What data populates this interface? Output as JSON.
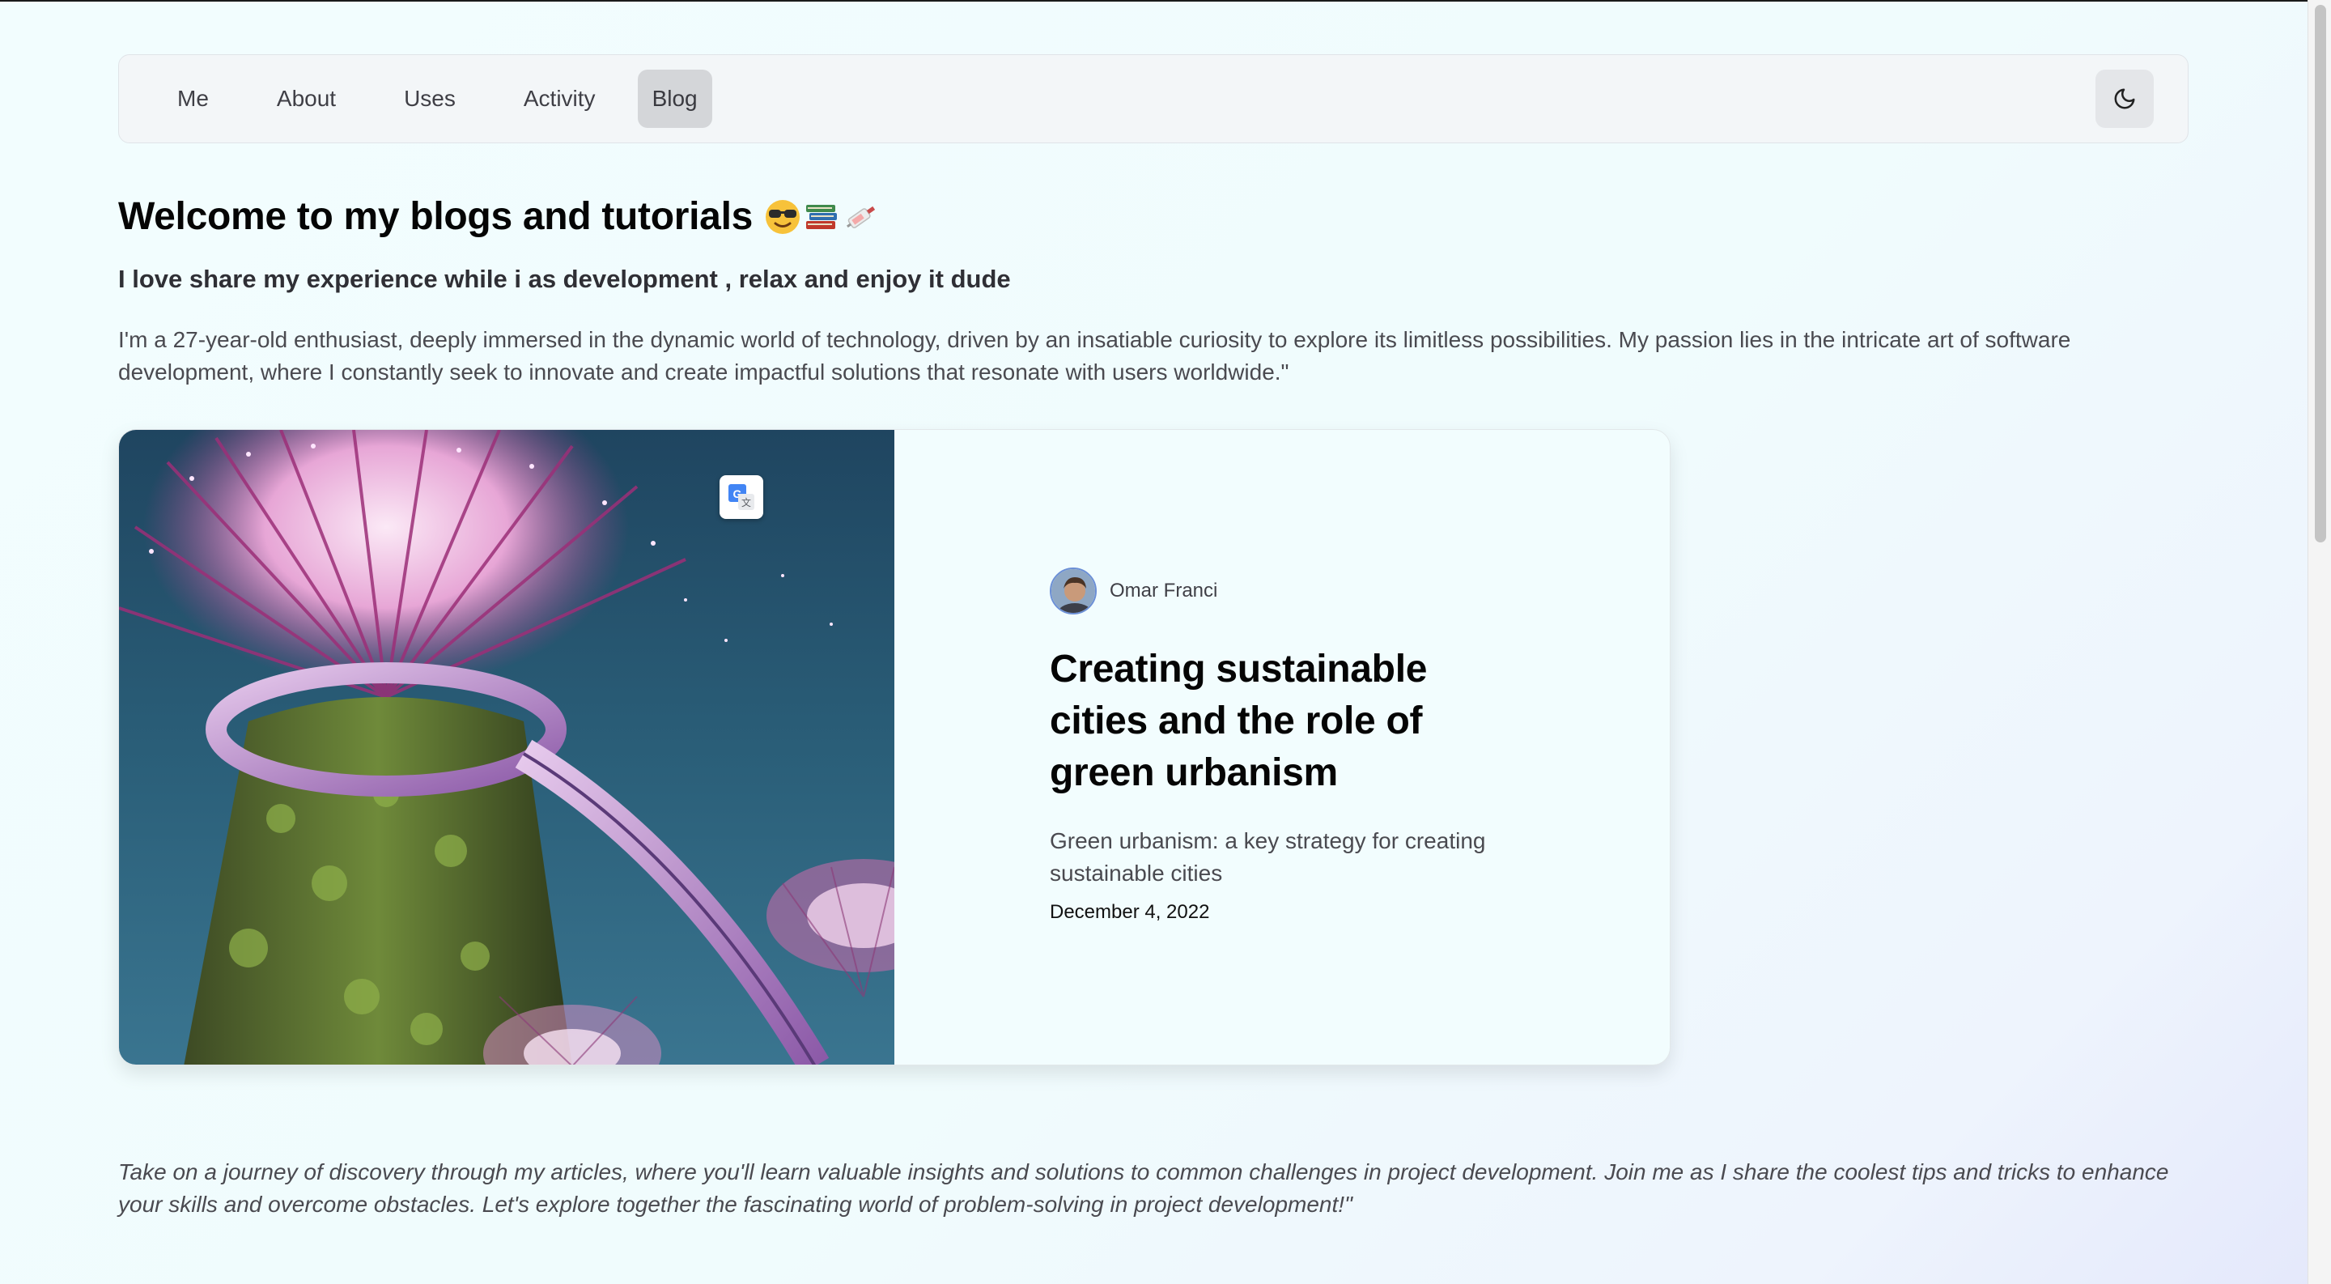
{
  "nav": {
    "items": [
      {
        "label": "Me"
      },
      {
        "label": "About"
      },
      {
        "label": "Uses"
      },
      {
        "label": "Activity"
      },
      {
        "label": "Blog",
        "active": true
      }
    ],
    "theme_toggle_icon": "moon-icon"
  },
  "header": {
    "title": "Welcome to my blogs and tutorials",
    "title_emojis": [
      "sunglasses-emoji",
      "books-emoji",
      "syringe-tag-emoji"
    ],
    "subtitle": "I love share my experience while i as development , relax and enjoy it dude",
    "intro": "I'm a 27-year-old enthusiast, deeply immersed in the dynamic world of technology, driven by an insatiable curiosity to explore its limitless possibilities. My passion lies in the intricate art of software development, where I constantly seek to innovate and create impactful solutions that resonate with users worldwide.\""
  },
  "post": {
    "author": "Omar Franci",
    "title": "Creating sustainable cities and the role of green urbanism",
    "description": "Green urbanism: a key strategy for creating sustainable cities",
    "date": "December 4, 2022",
    "image_icon": "supertree-grove-photo"
  },
  "footer": {
    "outro": "Take on a journey of discovery through my articles, where you'll learn valuable insights and solutions to common challenges in project development. Join me as I share the coolest tips and tricks to enhance your skills and overcome obstacles. Let's explore together the fascinating world of problem-solving in project development!\""
  },
  "colors": {
    "background": "#f2fdfe",
    "nav_bg": "#f3f6f8",
    "active_tab": "#d4d6d9",
    "text_muted": "#4a4a50"
  }
}
